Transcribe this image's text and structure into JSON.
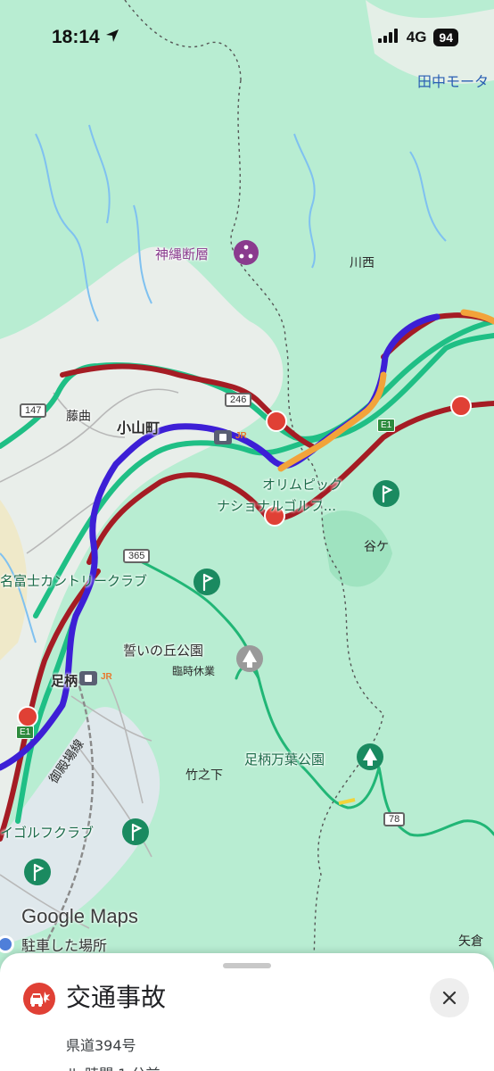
{
  "status_bar": {
    "time": "18:14",
    "network": "4G",
    "battery": "94"
  },
  "map": {
    "labels": {
      "tanaka": "田中モータ",
      "fault": "神縄断層",
      "kawanishi": "川西",
      "fujimagari": "藤曲",
      "oyama_town": "小山町",
      "olympic_line1": "オリムピック",
      "olympic_line2": "ナショナルゴルフ...",
      "yagatake": "谷ケ",
      "country_club": "名富士カントリークラブ",
      "chikai_park": "誓いの丘公園",
      "temporarily_closed": "臨時休業",
      "ashigara": "足柄",
      "manyo_park": "足柄万葉公園",
      "takenoshita": "竹之下",
      "gotemba_line": "御殿場線",
      "golf_club": "イゴルフクラブ",
      "yagura": "矢倉"
    },
    "route_badges": {
      "r147": "147",
      "r246": "246",
      "r365": "365",
      "r78": "78",
      "e1_north": "E1",
      "e1_south": "E1"
    },
    "rail_badge": "JR",
    "google_logo": "Google Maps",
    "parked_label": "駐車した場所"
  },
  "incident": {
    "title": "交通事故",
    "road": "県道394号",
    "detail_partial": "ル 時間 1 分前"
  },
  "colors": {
    "route_active": "#3d1fd6",
    "traffic_heavy": "#a51c24",
    "traffic_moderate": "#f2a33a",
    "road_green": "#1fbf85",
    "incident_red": "#e04035"
  }
}
